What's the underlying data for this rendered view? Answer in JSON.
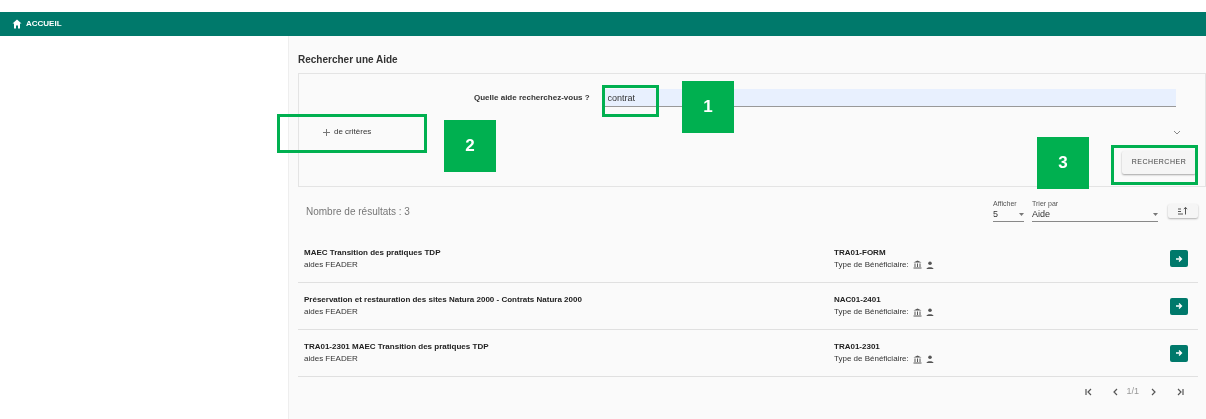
{
  "nav": {
    "label": "ACCUEIL"
  },
  "page_title": "Rechercher une Aide",
  "search": {
    "label": "Quelle aide recherchez-vous ?",
    "value": "contrat",
    "more_criteria": "de critères",
    "button": "RECHERCHER"
  },
  "annotations": [
    {
      "number": "1"
    },
    {
      "number": "2"
    },
    {
      "number": "3"
    }
  ],
  "results": {
    "count_label": "Nombre de résultats : 3",
    "page_size": {
      "label": "Afficher",
      "value": "5"
    },
    "sort": {
      "label": "Trier par",
      "value": "Aide"
    },
    "rows": [
      {
        "title": "MAEC Transition des pratiques TDP",
        "subtitle": "aides FEADER",
        "code": "TRA01-FORM",
        "beneficiary_label": "Type de Bénéficiaire:"
      },
      {
        "title": "Préservation et restauration des sites Natura 2000 - Contrats Natura 2000",
        "subtitle": "aides FEADER",
        "code": "NAC01-2401",
        "beneficiary_label": "Type de Bénéficiaire:"
      },
      {
        "title": "TRA01-2301 MAEC Transition des pratiques TDP",
        "subtitle": "aides FEADER",
        "code": "TRA01-2301",
        "beneficiary_label": "Type de Bénéficiaire:"
      }
    ],
    "pagination": "1/1"
  }
}
